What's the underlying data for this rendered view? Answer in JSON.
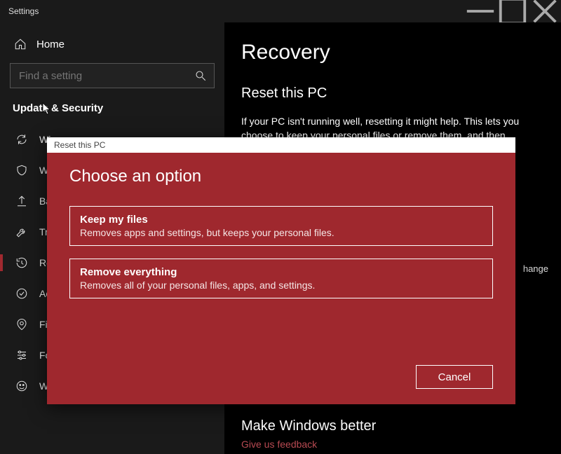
{
  "titlebar": {
    "app_title": "Settings"
  },
  "sidebar": {
    "home_label": "Home",
    "search_placeholder": "Find a setting",
    "section_heading": "Update & Security",
    "items": [
      {
        "label": "Wi",
        "icon": "sync"
      },
      {
        "label": "Wi",
        "icon": "shield"
      },
      {
        "label": "Bac",
        "icon": "upload"
      },
      {
        "label": "Tro",
        "icon": "wrench"
      },
      {
        "label": "Rec",
        "icon": "history"
      },
      {
        "label": "Act",
        "icon": "check"
      },
      {
        "label": "Fin",
        "icon": "find"
      },
      {
        "label": "For",
        "icon": "sliders"
      },
      {
        "label": "Windows Insider Program",
        "icon": "insider"
      }
    ]
  },
  "main": {
    "heading": "Recovery",
    "subheading": "Reset this PC",
    "description": "If your PC isn't running well, resetting it might help. This lets you choose to keep your personal files or remove them, and then",
    "peek_change": "hange",
    "footer_heading": "Make Windows better",
    "feedback_link": "Give us feedback"
  },
  "dialog": {
    "title": "Reset this PC",
    "heading": "Choose an option",
    "options": [
      {
        "title": "Keep my files",
        "desc": "Removes apps and settings, but keeps your personal files."
      },
      {
        "title": "Remove everything",
        "desc": "Removes all of your personal files, apps, and settings."
      }
    ],
    "cancel_label": "Cancel"
  }
}
